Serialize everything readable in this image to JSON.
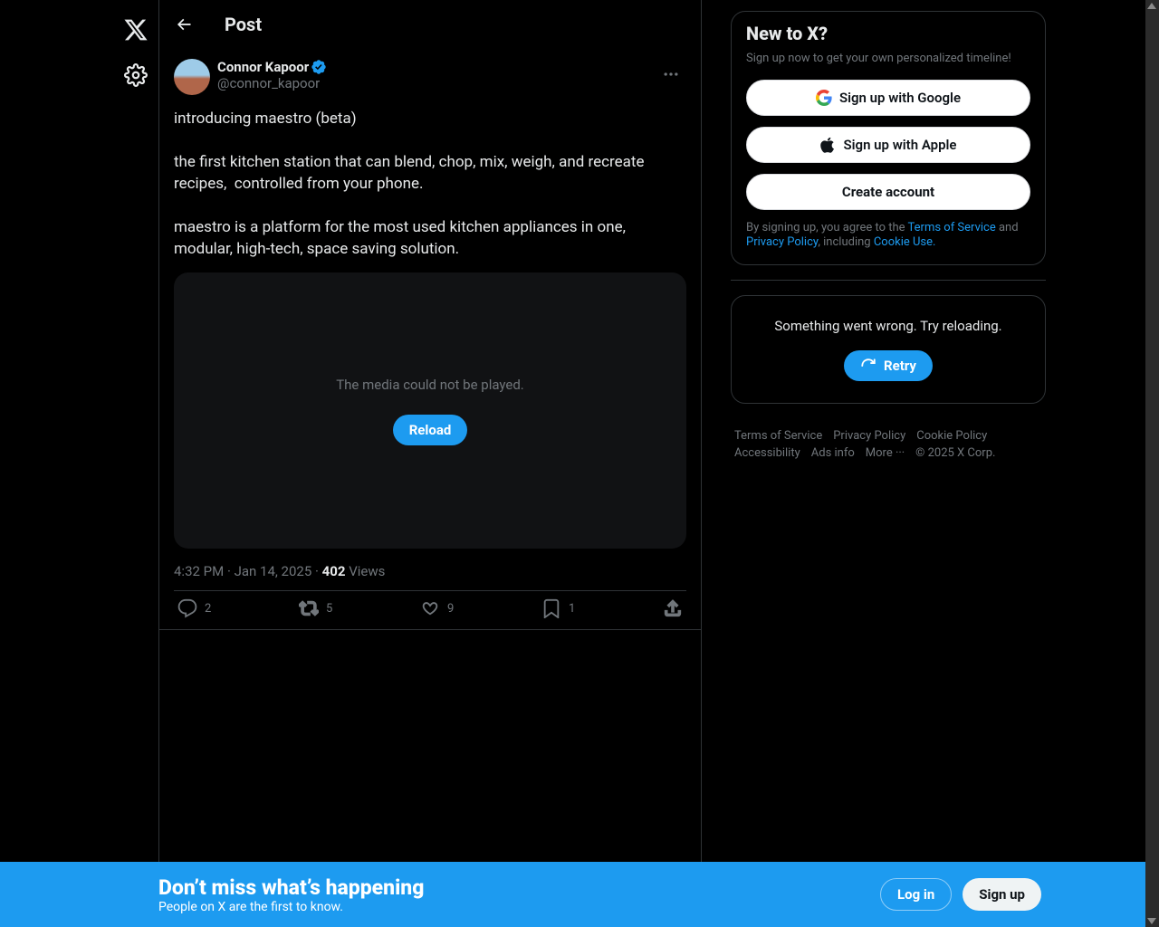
{
  "header": {
    "title": "Post"
  },
  "post": {
    "author_name": "Connor Kapoor",
    "author_handle": "@connor_kapoor",
    "text": "introducing maestro (beta)\n\nthe first kitchen station that can blend, chop, mix, weigh, and recreate recipes,  controlled from your phone.\n\nmaestro is a platform for the most used kitchen appliances in one, modular, high-tech, space saving solution.",
    "media_error": "The media could not be played.",
    "reload_label": "Reload",
    "time": "4:32 PM",
    "date": "Jan 14, 2025",
    "views_count": "402",
    "views_label": "Views",
    "replies": "2",
    "retweets": "5",
    "likes": "9",
    "bookmarks": "1"
  },
  "signup": {
    "title": "New to X?",
    "subtitle": "Sign up now to get your own personalized timeline!",
    "google_label": "Sign up with Google",
    "apple_label": "Sign up with Apple",
    "create_label": "Create account",
    "legal_prefix": "By signing up, you agree to the ",
    "tos": "Terms of Service",
    "and": " and ",
    "privacy": "Privacy Policy",
    "including": ", including ",
    "cookie": "Cookie Use."
  },
  "error_box": {
    "message": "Something went wrong. Try reloading.",
    "retry_label": "Retry"
  },
  "footer": {
    "items": [
      "Terms of Service",
      "Privacy Policy",
      "Cookie Policy",
      "Accessibility",
      "Ads info",
      "More ···",
      "© 2025 X Corp."
    ]
  },
  "bottom": {
    "title": "Don’t miss what’s happening",
    "subtitle": "People on X are the first to know.",
    "login_label": "Log in",
    "signup_label": "Sign up"
  }
}
